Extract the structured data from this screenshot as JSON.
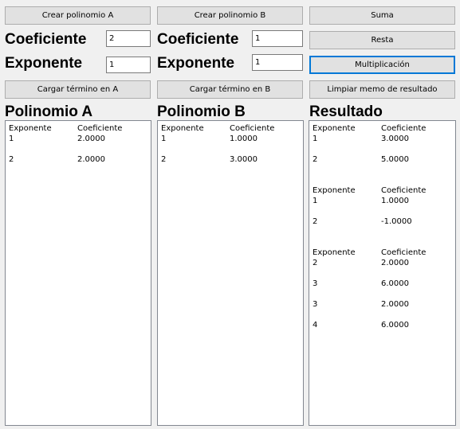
{
  "buttons": {
    "crear_a": "Crear polinomio A",
    "crear_b": "Crear polinomio B",
    "suma": "Suma",
    "resta": "Resta",
    "multiplicacion": "Multiplicación",
    "cargar_a": "Cargar término en A",
    "cargar_b": "Cargar término en B",
    "limpiar": "Limpiar memo de resultado"
  },
  "panel_a": {
    "coef_label": "Coeficiente",
    "coef_value": "2",
    "exp_label": "Exponente",
    "exp_value": "1",
    "title": "Polinomio A"
  },
  "panel_b": {
    "coef_label": "Coeficiente",
    "coef_value": "1",
    "exp_label": "Exponente",
    "exp_value": "1",
    "title": "Polinomio B"
  },
  "resultado_title": "Resultado",
  "memo_a": [
    {
      "c1": "Exponente",
      "c2": "Coeficiente"
    },
    {
      "c1": "1",
      "c2": "2.0000"
    },
    {
      "c1": "",
      "c2": ""
    },
    {
      "c1": "2",
      "c2": "2.0000"
    }
  ],
  "memo_b": [
    {
      "c1": "Exponente",
      "c2": "Coeficiente"
    },
    {
      "c1": "1",
      "c2": "1.0000"
    },
    {
      "c1": "",
      "c2": ""
    },
    {
      "c1": "2",
      "c2": "3.0000"
    }
  ],
  "memo_r": [
    {
      "c1": "Exponente",
      "c2": "Coeficiente"
    },
    {
      "c1": "1",
      "c2": "3.0000"
    },
    {
      "c1": "",
      "c2": ""
    },
    {
      "c1": "2",
      "c2": "5.0000"
    },
    {
      "c1": "",
      "c2": ""
    },
    {
      "c1": "",
      "c2": ""
    },
    {
      "c1": "Exponente",
      "c2": "Coeficiente"
    },
    {
      "c1": "1",
      "c2": "1.0000"
    },
    {
      "c1": "",
      "c2": ""
    },
    {
      "c1": "2",
      "c2": "-1.0000"
    },
    {
      "c1": "",
      "c2": ""
    },
    {
      "c1": "",
      "c2": ""
    },
    {
      "c1": "Exponente",
      "c2": "Coeficiente"
    },
    {
      "c1": "2",
      "c2": "2.0000"
    },
    {
      "c1": "",
      "c2": ""
    },
    {
      "c1": "3",
      "c2": "6.0000"
    },
    {
      "c1": "",
      "c2": ""
    },
    {
      "c1": "3",
      "c2": "2.0000"
    },
    {
      "c1": "",
      "c2": ""
    },
    {
      "c1": "4",
      "c2": "6.0000"
    }
  ]
}
